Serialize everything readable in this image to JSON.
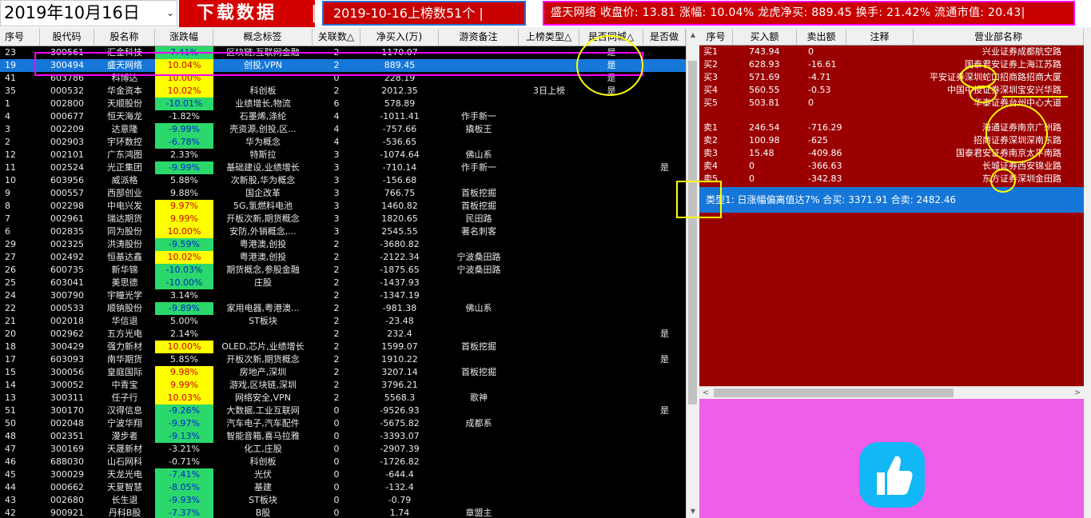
{
  "topbar": {
    "date": "2019年10月16日",
    "dropdown_glyph": "⌄",
    "download_label": "下载数据",
    "separator": "|",
    "count_text": "2019-10-16上榜数51个  |",
    "ticker_text": "盛天网络 收盘价: 13.81 涨幅: 10.04% 龙虎净买: 889.45 换手: 21.42% 流通市值: 20.43|"
  },
  "table": {
    "headers": [
      "序号",
      "股代码",
      "股名称",
      "涨跌幅",
      "概念标签",
      "关联数△",
      "净买入(万)",
      "游资备注",
      "上榜类型△",
      "是否同城△",
      "是否做"
    ],
    "rows": [
      {
        "seq": "23",
        "code": "300561",
        "name": "汇金科技",
        "pct": "7.41%",
        "pct_style": "g",
        "concept": "区块链,互联网金融",
        "rel": "2",
        "net": "1170.07",
        "note": "",
        "type": "",
        "same": "是",
        "last": ""
      },
      {
        "seq": "19",
        "code": "300494",
        "name": "盛天网络",
        "pct": "10.04%",
        "pct_style": "y",
        "concept": "创投,VPN",
        "rel": "2",
        "net": "889.45",
        "note": "",
        "type": "",
        "same": "是",
        "last": "",
        "selected": true
      },
      {
        "seq": "41",
        "code": "603786",
        "name": "科博达",
        "pct": "10.00%",
        "pct_style": "y",
        "concept": "",
        "rel": "0",
        "net": "228.19",
        "note": "",
        "type": "",
        "same": "是",
        "last": ""
      },
      {
        "seq": "35",
        "code": "000532",
        "name": "华金资本",
        "pct": "10.02%",
        "pct_style": "y",
        "concept": "科创板",
        "rel": "2",
        "net": "2012.35",
        "note": "",
        "type": "3日上榜",
        "same": "是",
        "last": ""
      },
      {
        "seq": "1",
        "code": "002800",
        "name": "天顺股份",
        "pct": "-10.01%",
        "pct_style": "g",
        "concept": "业绩增长,物流",
        "rel": "6",
        "net": "578.89",
        "note": "",
        "type": "",
        "same": "",
        "last": ""
      },
      {
        "seq": "4",
        "code": "000677",
        "name": "恒天海龙",
        "pct": "-1.82%",
        "pct_style": "",
        "concept": "石墨烯,涤纶",
        "rel": "4",
        "net": "-1011.41",
        "note": "作手新一",
        "type": "",
        "same": "",
        "last": ""
      },
      {
        "seq": "3",
        "code": "002209",
        "name": "达意隆",
        "pct": "-9.99%",
        "pct_style": "g",
        "concept": "壳资源,创投,区...",
        "rel": "4",
        "net": "-757.66",
        "note": "撬板王",
        "type": "",
        "same": "",
        "last": ""
      },
      {
        "seq": "2",
        "code": "002903",
        "name": "宇环数控",
        "pct": "-6.78%",
        "pct_style": "g",
        "concept": "华为概念",
        "rel": "4",
        "net": "-536.65",
        "note": "",
        "type": "",
        "same": "",
        "last": ""
      },
      {
        "seq": "12",
        "code": "002101",
        "name": "广东鸿图",
        "pct": "2.33%",
        "pct_style": "",
        "concept": "特斯拉",
        "rel": "3",
        "net": "-1074.64",
        "note": "佛山系",
        "type": "",
        "same": "",
        "last": ""
      },
      {
        "seq": "11",
        "code": "002524",
        "name": "光正集团",
        "pct": "-9.99%",
        "pct_style": "g",
        "concept": "基础建设,业绩增长",
        "rel": "3",
        "net": "-710.14",
        "note": "作手新一",
        "type": "",
        "same": "",
        "last": "是"
      },
      {
        "seq": "10",
        "code": "603956",
        "name": "威派格",
        "pct": "5.88%",
        "pct_style": "",
        "concept": "次新股,华为概念",
        "rel": "3",
        "net": "-156.68",
        "note": "",
        "type": "",
        "same": "",
        "last": ""
      },
      {
        "seq": "9",
        "code": "000557",
        "name": "西部创业",
        "pct": "9.88%",
        "pct_style": "",
        "concept": "国企改革",
        "rel": "3",
        "net": "766.75",
        "note": "首板挖掘",
        "type": "",
        "same": "",
        "last": ""
      },
      {
        "seq": "8",
        "code": "002298",
        "name": "中电兴发",
        "pct": "9.97%",
        "pct_style": "y",
        "concept": "5G,氢燃料电池",
        "rel": "3",
        "net": "1460.82",
        "note": "首板挖掘",
        "type": "",
        "same": "",
        "last": ""
      },
      {
        "seq": "7",
        "code": "002961",
        "name": "瑞达期货",
        "pct": "9.99%",
        "pct_style": "y",
        "concept": "开板次新,期货概念",
        "rel": "3",
        "net": "1820.65",
        "note": "民田路",
        "type": "",
        "same": "",
        "last": ""
      },
      {
        "seq": "6",
        "code": "002835",
        "name": "同为股份",
        "pct": "10.00%",
        "pct_style": "y",
        "concept": "安防,外销概念,...",
        "rel": "3",
        "net": "2545.55",
        "note": "著名刺客",
        "type": "",
        "same": "",
        "last": ""
      },
      {
        "seq": "29",
        "code": "002325",
        "name": "洪涛股份",
        "pct": "-9.59%",
        "pct_style": "g",
        "concept": "粤港澳,创投",
        "rel": "2",
        "net": "-3680.82",
        "note": "",
        "type": "",
        "same": "",
        "last": ""
      },
      {
        "seq": "27",
        "code": "002492",
        "name": "恒基达鑫",
        "pct": "10.02%",
        "pct_style": "y",
        "concept": "粤港澳,创投",
        "rel": "2",
        "net": "-2122.34",
        "note": "宁波桑田路",
        "type": "",
        "same": "",
        "last": ""
      },
      {
        "seq": "26",
        "code": "600735",
        "name": "新华锦",
        "pct": "-10.03%",
        "pct_style": "g",
        "concept": "期货概念,参股金融",
        "rel": "2",
        "net": "-1875.65",
        "note": "宁波桑田路",
        "type": "",
        "same": "",
        "last": ""
      },
      {
        "seq": "25",
        "code": "603041",
        "name": "美思德",
        "pct": "-10.00%",
        "pct_style": "g",
        "concept": "庄股",
        "rel": "2",
        "net": "-1437.93",
        "note": "",
        "type": "",
        "same": "",
        "last": ""
      },
      {
        "seq": "24",
        "code": "300790",
        "name": "宇瞳光学",
        "pct": "3.14%",
        "pct_style": "",
        "concept": "",
        "rel": "2",
        "net": "-1347.19",
        "note": "",
        "type": "",
        "same": "",
        "last": ""
      },
      {
        "seq": "22",
        "code": "000533",
        "name": "顺钠股份",
        "pct": "-9.89%",
        "pct_style": "g",
        "concept": "家用电器,粤港澳...",
        "rel": "2",
        "net": "-981.38",
        "note": "佛山系",
        "type": "",
        "same": "",
        "last": ""
      },
      {
        "seq": "21",
        "code": "002018",
        "name": "华信退",
        "pct": "5.00%",
        "pct_style": "",
        "concept": "ST板块",
        "rel": "2",
        "net": "-23.48",
        "note": "",
        "type": "",
        "same": "",
        "last": ""
      },
      {
        "seq": "20",
        "code": "002962",
        "name": "五方光电",
        "pct": "2.14%",
        "pct_style": "",
        "concept": "",
        "rel": "2",
        "net": "232.4",
        "note": "",
        "type": "",
        "same": "",
        "last": "是"
      },
      {
        "seq": "18",
        "code": "300429",
        "name": "强力新材",
        "pct": "10.00%",
        "pct_style": "y",
        "concept": "OLED,芯片,业绩增长",
        "rel": "2",
        "net": "1599.07",
        "note": "首板挖掘",
        "type": "",
        "same": "",
        "last": ""
      },
      {
        "seq": "17",
        "code": "603093",
        "name": "南华期货",
        "pct": "5.85%",
        "pct_style": "",
        "concept": "开板次新,期货概念",
        "rel": "2",
        "net": "1910.22",
        "note": "",
        "type": "",
        "same": "",
        "last": "是"
      },
      {
        "seq": "15",
        "code": "300056",
        "name": "皇庭国际",
        "pct": "9.98%",
        "pct_style": "y",
        "concept": "房地产,深圳",
        "rel": "2",
        "net": "3207.14",
        "note": "首板挖掘",
        "type": "",
        "same": "",
        "last": ""
      },
      {
        "seq": "14",
        "code": "300052",
        "name": "中青宝",
        "pct": "9.99%",
        "pct_style": "y",
        "concept": "游戏,区块链,深圳",
        "rel": "2",
        "net": "3796.21",
        "note": "",
        "type": "",
        "same": "",
        "last": ""
      },
      {
        "seq": "13",
        "code": "300311",
        "name": "任子行",
        "pct": "10.03%",
        "pct_style": "y",
        "concept": "网络安全,VPN",
        "rel": "2",
        "net": "5568.3",
        "note": "歌神",
        "type": "",
        "same": "",
        "last": ""
      },
      {
        "seq": "51",
        "code": "300170",
        "name": "汉得信息",
        "pct": "-9.26%",
        "pct_style": "g",
        "concept": "大数据,工业互联网",
        "rel": "0",
        "net": "-9526.93",
        "note": "",
        "type": "",
        "same": "",
        "last": "是"
      },
      {
        "seq": "50",
        "code": "002048",
        "name": "宁波华翔",
        "pct": "-9.97%",
        "pct_style": "g",
        "concept": "汽车电子,汽车配件",
        "rel": "0",
        "net": "-5675.82",
        "note": "成都系",
        "type": "",
        "same": "",
        "last": ""
      },
      {
        "seq": "48",
        "code": "002351",
        "name": "漫步者",
        "pct": "-9.13%",
        "pct_style": "g",
        "concept": "智能音箱,喜马拉雅",
        "rel": "0",
        "net": "-3393.07",
        "note": "",
        "type": "",
        "same": "",
        "last": ""
      },
      {
        "seq": "47",
        "code": "300169",
        "name": "天晟新材",
        "pct": "-3.21%",
        "pct_style": "",
        "concept": "化工,庄股",
        "rel": "0",
        "net": "-2907.39",
        "note": "",
        "type": "",
        "same": "",
        "last": ""
      },
      {
        "seq": "46",
        "code": "688030",
        "name": "山石网科",
        "pct": "-0.71%",
        "pct_style": "",
        "concept": "科创板",
        "rel": "0",
        "net": "-1726.82",
        "note": "",
        "type": "",
        "same": "",
        "last": ""
      },
      {
        "seq": "45",
        "code": "300029",
        "name": "天龙光电",
        "pct": "-7.41%",
        "pct_style": "g",
        "concept": "光伏",
        "rel": "0",
        "net": "-644.4",
        "note": "",
        "type": "",
        "same": "",
        "last": ""
      },
      {
        "seq": "44",
        "code": "000662",
        "name": "天夏智慧",
        "pct": "-8.05%",
        "pct_style": "g",
        "concept": "基建",
        "rel": "0",
        "net": "-132.4",
        "note": "",
        "type": "",
        "same": "",
        "last": ""
      },
      {
        "seq": "43",
        "code": "002680",
        "name": "长生退",
        "pct": "-9.93%",
        "pct_style": "g",
        "concept": "ST板块",
        "rel": "0",
        "net": "-0.79",
        "note": "",
        "type": "",
        "same": "",
        "last": ""
      },
      {
        "seq": "42",
        "code": "900921",
        "name": "丹科B股",
        "pct": "-7.37%",
        "pct_style": "g",
        "concept": "B股",
        "rel": "0",
        "net": "1.74",
        "note": "章盟主",
        "type": "",
        "same": "",
        "last": ""
      }
    ]
  },
  "seats": {
    "headers": [
      "序号",
      "买入额",
      "卖出额",
      "注释",
      "营业部名称"
    ],
    "buys": [
      {
        "seq": "买1",
        "buy": "743.94",
        "sell": "0",
        "note": "",
        "dept": "兴业证券成都航空路"
      },
      {
        "seq": "买2",
        "buy": "628.93",
        "sell": "-16.61",
        "note": "",
        "dept": "国泰君安证券上海江苏路"
      },
      {
        "seq": "买3",
        "buy": "571.69",
        "sell": "-4.71",
        "note": "",
        "dept": "平安证券深圳蛇口招商路招商大厦"
      },
      {
        "seq": "买4",
        "buy": "560.55",
        "sell": "-0.53",
        "note": "",
        "dept": "中国中投证券深圳宝安兴华路"
      },
      {
        "seq": "买5",
        "buy": "503.81",
        "sell": "0",
        "note": "",
        "dept": "华泰证券台州中心大道"
      }
    ],
    "sells": [
      {
        "seq": "卖1",
        "buy": "246.54",
        "sell": "-716.29",
        "note": "",
        "dept": "海通证券南京广州路"
      },
      {
        "seq": "卖2",
        "buy": "100.98",
        "sell": "-625",
        "note": "",
        "dept": "招商证券深圳深南东路"
      },
      {
        "seq": "卖3",
        "buy": "15.48",
        "sell": "-409.86",
        "note": "",
        "dept": "国泰君安证券南京太平南路"
      },
      {
        "seq": "卖4",
        "buy": "0",
        "sell": "-366.63",
        "note": "",
        "dept": "长城证券西安锦业路"
      },
      {
        "seq": "卖5",
        "buy": "0",
        "sell": "-342.83",
        "note": "",
        "dept": "东方证券深圳金田路"
      }
    ],
    "summary": "类型1: 日涨幅偏离值达7% 合买: 3371.91 合卖: 2482.46"
  },
  "scroll": {
    "up": "▲",
    "down": "▼",
    "left": "<",
    "right": ">"
  },
  "icons": {
    "thumbs_up": "thumbs-up-icon"
  },
  "colors": {
    "accent_red": "#c80000",
    "panel_red": "#9b0000",
    "select_blue": "#1677d9",
    "up_yellow": "#ffff00",
    "down_green": "#2bd86b",
    "pink_panel": "#ee5ee8",
    "annotation_magenta": "#ff00ff",
    "annotation_yellow": "#ffff00"
  }
}
